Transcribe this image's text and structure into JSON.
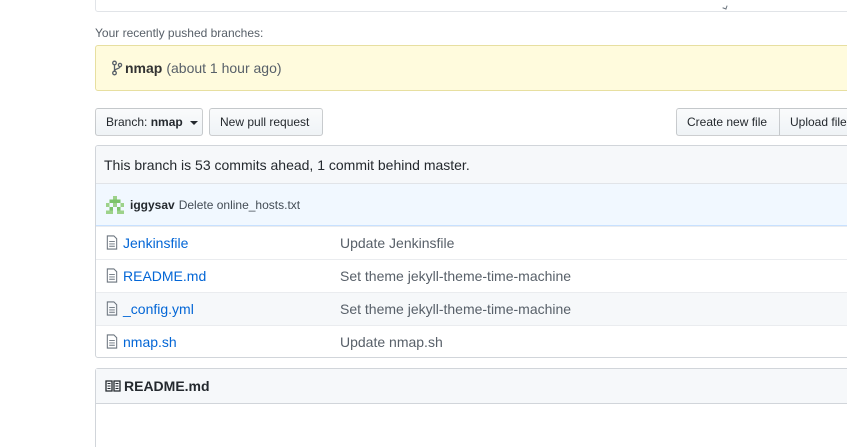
{
  "recent": {
    "label": "Your recently pushed branches:",
    "branch": "nmap",
    "time": "(about 1 hour ago)"
  },
  "toolbar": {
    "branch_prefix": "Branch:",
    "branch_value": "nmap",
    "new_pr": "New pull request",
    "create_file": "Create new file",
    "upload_files": "Upload files"
  },
  "compare": {
    "text": "This branch is 53 commits ahead, 1 commit behind master."
  },
  "commit": {
    "author": "iggysav",
    "message": "Delete online_hosts.txt"
  },
  "files": [
    {
      "name": "Jenkinsfile",
      "message": "Update Jenkinsfile",
      "icon": "file-icon"
    },
    {
      "name": "README.md",
      "message": "Set theme jekyll-theme-time-machine",
      "icon": "file-icon"
    },
    {
      "name": "_config.yml",
      "message": "Set theme jekyll-theme-time-machine",
      "icon": "file-icon"
    },
    {
      "name": "nmap.sh",
      "message": "Update nmap.sh",
      "icon": "file-icon"
    }
  ],
  "readme": {
    "title": "README.md",
    "icon": "book-icon"
  },
  "colors": {
    "link": "#0366d6",
    "banner_bg": "#fffbdd",
    "commit_bg": "#f1f8ff"
  }
}
